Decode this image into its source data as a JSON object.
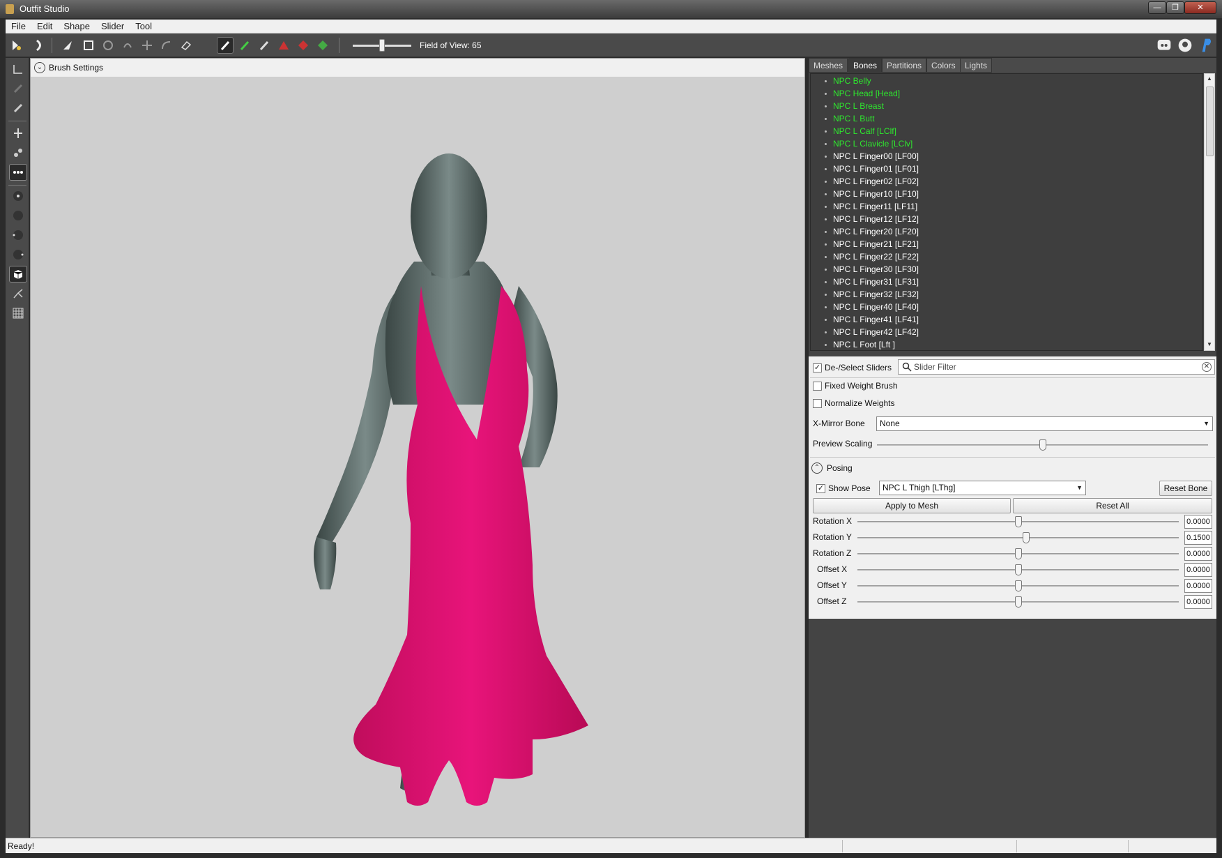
{
  "window": {
    "title": "Outfit Studio",
    "min_label": "—",
    "max_label": "❐",
    "close_label": "✕"
  },
  "menu": [
    "File",
    "Edit",
    "Shape",
    "Slider",
    "Tool"
  ],
  "toolbar": {
    "fov_label": "Field of View: 65",
    "fov_value": 65
  },
  "viewport": {
    "brush_settings_label": "Brush Settings",
    "dress_color": "#e0126b",
    "body_color": "#4f5d5b",
    "background": "#cfcfcf"
  },
  "tabs": [
    {
      "label": "Meshes",
      "active": false
    },
    {
      "label": "Bones",
      "active": true
    },
    {
      "label": "Partitions",
      "active": false
    },
    {
      "label": "Colors",
      "active": false
    },
    {
      "label": "Lights",
      "active": false
    }
  ],
  "bones": [
    {
      "label": "NPC Belly",
      "highlight": true
    },
    {
      "label": "NPC Head [Head]",
      "highlight": true
    },
    {
      "label": "NPC L Breast",
      "highlight": true
    },
    {
      "label": "NPC L Butt",
      "highlight": true
    },
    {
      "label": "NPC L Calf [LClf]",
      "highlight": true
    },
    {
      "label": "NPC L Clavicle [LClv]",
      "highlight": true
    },
    {
      "label": "NPC L Finger00 [LF00]",
      "highlight": false
    },
    {
      "label": "NPC L Finger01 [LF01]",
      "highlight": false
    },
    {
      "label": "NPC L Finger02 [LF02]",
      "highlight": false
    },
    {
      "label": "NPC L Finger10 [LF10]",
      "highlight": false
    },
    {
      "label": "NPC L Finger11 [LF11]",
      "highlight": false
    },
    {
      "label": "NPC L Finger12 [LF12]",
      "highlight": false
    },
    {
      "label": "NPC L Finger20 [LF20]",
      "highlight": false
    },
    {
      "label": "NPC L Finger21 [LF21]",
      "highlight": false
    },
    {
      "label": "NPC L Finger22 [LF22]",
      "highlight": false
    },
    {
      "label": "NPC L Finger30 [LF30]",
      "highlight": false
    },
    {
      "label": "NPC L Finger31 [LF31]",
      "highlight": false
    },
    {
      "label": "NPC L Finger32 [LF32]",
      "highlight": false
    },
    {
      "label": "NPC L Finger40 [LF40]",
      "highlight": false
    },
    {
      "label": "NPC L Finger41 [LF41]",
      "highlight": false
    },
    {
      "label": "NPC L Finger42 [LF42]",
      "highlight": false
    },
    {
      "label": "NPC L Foot [Lft ]",
      "highlight": false
    }
  ],
  "controls": {
    "deselect_sliders": "De-/Select Sliders",
    "slider_filter_placeholder": "Slider Filter",
    "fixed_weight_brush": "Fixed Weight Brush",
    "normalize_weights": "Normalize Weights",
    "xmirror_label": "X-Mirror Bone",
    "xmirror_value": "None",
    "preview_scaling_label": "Preview Scaling",
    "preview_scaling_level": 0.5
  },
  "posing": {
    "header": "Posing",
    "show_pose": "Show Pose",
    "bone_value": "NPC L Thigh [LThg]",
    "reset_bone": "Reset Bone",
    "apply_to_mesh": "Apply to Mesh",
    "reset_all": "Reset All",
    "rows": [
      {
        "label": "Rotation X",
        "value": "0.0000",
        "level": 0.5
      },
      {
        "label": "Rotation Y",
        "value": "0.1500",
        "level": 0.525
      },
      {
        "label": "Rotation Z",
        "value": "0.0000",
        "level": 0.5
      },
      {
        "label": "Offset X",
        "value": "0.0000",
        "level": 0.5
      },
      {
        "label": "Offset Y",
        "value": "0.0000",
        "level": 0.5
      },
      {
        "label": "Offset Z",
        "value": "0.0000",
        "level": 0.5
      }
    ]
  },
  "status": {
    "text": "Ready!"
  }
}
